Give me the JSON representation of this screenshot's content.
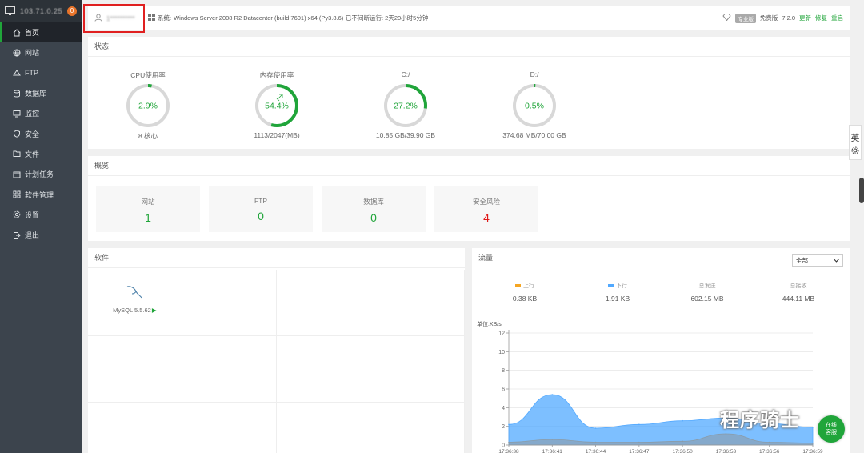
{
  "sidebar": {
    "ip": "103.71.0.25",
    "badge": "0",
    "items": [
      {
        "label": "首页",
        "icon": "home-icon",
        "active": true
      },
      {
        "label": "网站",
        "icon": "globe-icon"
      },
      {
        "label": "FTP",
        "icon": "ftp-icon"
      },
      {
        "label": "数据库",
        "icon": "database-icon"
      },
      {
        "label": "监控",
        "icon": "monitor-icon"
      },
      {
        "label": "安全",
        "icon": "shield-icon"
      },
      {
        "label": "文件",
        "icon": "folder-icon"
      },
      {
        "label": "计划任务",
        "icon": "calendar-icon"
      },
      {
        "label": "软件管理",
        "icon": "apps-icon"
      },
      {
        "label": "设置",
        "icon": "gear-icon"
      },
      {
        "label": "退出",
        "icon": "logout-icon"
      }
    ]
  },
  "topbar": {
    "user": "1**********",
    "system_label": "系统:",
    "system": "Windows Server 2008 R2 Datacenter (build 7601) x64 (Py3.8.6)",
    "uptime": "已不间断运行: 2天20小时5分钟",
    "edition_badge": "专业版",
    "edition": "免费版",
    "version": "7.2.0",
    "update": "更新",
    "repair": "修复",
    "restart": "重启"
  },
  "status": {
    "title": "状态",
    "gauges": [
      {
        "label": "CPU使用率",
        "value": "2.9%",
        "percent": 2.9,
        "sub": "8 核心"
      },
      {
        "label": "内存使用率",
        "value": "54.4%",
        "percent": 54.4,
        "sub": "1113/2047(MB)",
        "rocket": true
      },
      {
        "label": "C:/",
        "value": "27.2%",
        "percent": 27.2,
        "sub": "10.85 GB/39.90 GB"
      },
      {
        "label": "D:/",
        "value": "0.5%",
        "percent": 0.5,
        "sub": "374.68 MB/70.00 GB"
      }
    ]
  },
  "overview": {
    "title": "概览",
    "cards": [
      {
        "label": "网站",
        "value": "1"
      },
      {
        "label": "FTP",
        "value": "0"
      },
      {
        "label": "数据库",
        "value": "0"
      },
      {
        "label": "安全风险",
        "value": "4",
        "danger": true
      }
    ]
  },
  "software": {
    "title": "软件",
    "items": [
      {
        "name": "MySQL 5.5.62",
        "icon": "mysql-dolphin-icon"
      }
    ]
  },
  "traffic": {
    "title": "流量",
    "select": "全部",
    "stats": [
      {
        "label": "上行",
        "value": "0.38 KB",
        "color": "#f5a623"
      },
      {
        "label": "下行",
        "value": "1.91 KB",
        "color": "#52a9ff"
      },
      {
        "label": "总发送",
        "value": "602.15 MB"
      },
      {
        "label": "总接收",
        "value": "444.11 MB"
      }
    ]
  },
  "chart_data": {
    "type": "area",
    "ylabel": "单位:KB/s",
    "ylim": [
      0,
      12
    ],
    "yticks": [
      0,
      2,
      4,
      6,
      8,
      10,
      12
    ],
    "x": [
      "17:36:38",
      "17:36:41",
      "17:36:44",
      "17:36:47",
      "17:36:50",
      "17:36:53",
      "17:36:56",
      "17:36:59"
    ],
    "grid": true,
    "series": [
      {
        "name": "下行",
        "color": "#52a9ff",
        "values": [
          2.2,
          5.4,
          1.8,
          2.2,
          2.6,
          2.9,
          2.3,
          1.9
        ]
      },
      {
        "name": "上行",
        "color": "#8a9ba8",
        "values": [
          0.3,
          0.6,
          0.3,
          0.3,
          0.4,
          1.2,
          0.3,
          0.2
        ]
      }
    ]
  },
  "widgets": {
    "lang": "英",
    "watermark": "程序骑士",
    "online_service": [
      "在线",
      "客服"
    ]
  }
}
